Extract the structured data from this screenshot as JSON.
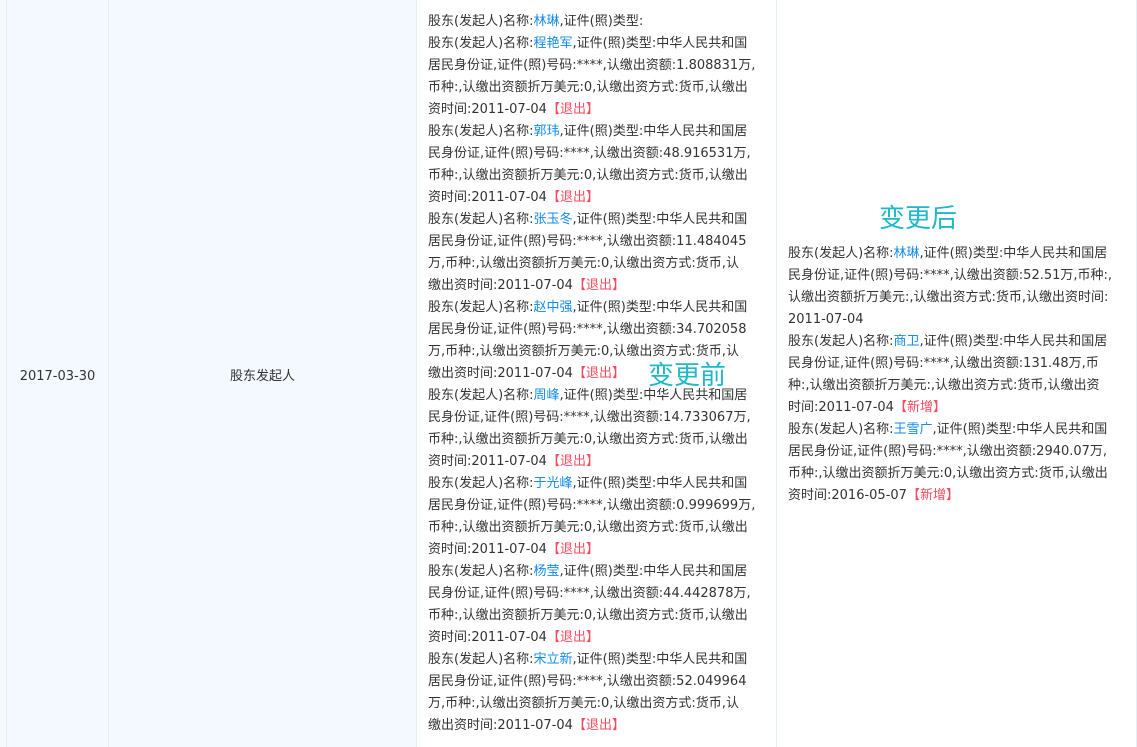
{
  "row": {
    "date": "2017-03-30",
    "item": "股东发起人"
  },
  "before": {
    "label": "变更前",
    "lines": [
      [
        [
          "t",
          "股东(发起人)名称:"
        ],
        [
          "l",
          "林琳"
        ],
        [
          "t",
          ",证件(照)类型:"
        ]
      ],
      [
        [
          "t",
          "股东(发起人)名称:"
        ],
        [
          "l",
          "程艳军"
        ],
        [
          "t",
          ",证件(照)类型:中华人民共和国"
        ]
      ],
      [
        [
          "t",
          "居民身份证,证件(照)号码:****,认缴出资额:1.808831万,"
        ]
      ],
      [
        [
          "t",
          "币种:,认缴出资额折万美元:0,认缴出资方式:货币,认缴出"
        ]
      ],
      [
        [
          "t",
          "资时间:2011-07-04"
        ],
        [
          "x",
          "【退出】"
        ]
      ],
      [
        [
          "t",
          "股东(发起人)名称:"
        ],
        [
          "l",
          "郭玮"
        ],
        [
          "t",
          ",证件(照)类型:中华人民共和国居"
        ]
      ],
      [
        [
          "t",
          "民身份证,证件(照)号码:****,认缴出资额:48.916531万,"
        ]
      ],
      [
        [
          "t",
          "币种:,认缴出资额折万美元:0,认缴出资方式:货币,认缴出"
        ]
      ],
      [
        [
          "t",
          "资时间:2011-07-04"
        ],
        [
          "x",
          "【退出】"
        ]
      ],
      [
        [
          "t",
          "股东(发起人)名称:"
        ],
        [
          "l",
          "张玉冬"
        ],
        [
          "t",
          ",证件(照)类型:中华人民共和国"
        ]
      ],
      [
        [
          "t",
          "居民身份证,证件(照)号码:****,认缴出资额:11.484045"
        ]
      ],
      [
        [
          "t",
          "万,币种:,认缴出资额折万美元:0,认缴出资方式:货币,认"
        ]
      ],
      [
        [
          "t",
          "缴出资时间:2011-07-04"
        ],
        [
          "x",
          "【退出】"
        ]
      ],
      [
        [
          "t",
          "股东(发起人)名称:"
        ],
        [
          "l",
          "赵中强"
        ],
        [
          "t",
          ",证件(照)类型:中华人民共和国"
        ]
      ],
      [
        [
          "t",
          "居民身份证,证件(照)号码:****,认缴出资额:34.702058"
        ]
      ],
      [
        [
          "t",
          "万,币种:,认缴出资额折万美元:0,认缴出资方式:货币,认"
        ]
      ],
      [
        [
          "t",
          "缴出资时间:2011-07-04"
        ],
        [
          "x",
          "【退出】"
        ]
      ],
      [
        [
          "t",
          "股东(发起人)名称:"
        ],
        [
          "l",
          "周峰"
        ],
        [
          "t",
          ",证件(照)类型:中华人民共和国居"
        ]
      ],
      [
        [
          "t",
          "民身份证,证件(照)号码:****,认缴出资额:14.733067万,"
        ]
      ],
      [
        [
          "t",
          "币种:,认缴出资额折万美元:0,认缴出资方式:货币,认缴出"
        ]
      ],
      [
        [
          "t",
          "资时间:2011-07-04"
        ],
        [
          "x",
          "【退出】"
        ]
      ],
      [
        [
          "t",
          "股东(发起人)名称:"
        ],
        [
          "l",
          "于光峰"
        ],
        [
          "t",
          ",证件(照)类型:中华人民共和国"
        ]
      ],
      [
        [
          "t",
          "居民身份证,证件(照)号码:****,认缴出资额:0.999699万,"
        ]
      ],
      [
        [
          "t",
          "币种:,认缴出资额折万美元:0,认缴出资方式:货币,认缴出"
        ]
      ],
      [
        [
          "t",
          "资时间:2011-07-04"
        ],
        [
          "x",
          "【退出】"
        ]
      ],
      [
        [
          "t",
          "股东(发起人)名称:"
        ],
        [
          "l",
          "杨莹"
        ],
        [
          "t",
          ",证件(照)类型:中华人民共和国居"
        ]
      ],
      [
        [
          "t",
          "民身份证,证件(照)号码:****,认缴出资额:44.442878万,"
        ]
      ],
      [
        [
          "t",
          "币种:,认缴出资额折万美元:0,认缴出资方式:货币,认缴出"
        ]
      ],
      [
        [
          "t",
          "资时间:2011-07-04"
        ],
        [
          "x",
          "【退出】"
        ]
      ],
      [
        [
          "t",
          "股东(发起人)名称:"
        ],
        [
          "l",
          "宋立新"
        ],
        [
          "t",
          ",证件(照)类型:中华人民共和国"
        ]
      ],
      [
        [
          "t",
          "居民身份证,证件(照)号码:****,认缴出资额:52.049964"
        ]
      ],
      [
        [
          "t",
          "万,币种:,认缴出资额折万美元:0,认缴出资方式:货币,认"
        ]
      ],
      [
        [
          "t",
          "缴出资时间:2011-07-04"
        ],
        [
          "x",
          "【退出】"
        ]
      ]
    ]
  },
  "after": {
    "label": "变更后",
    "lines": [
      [
        [
          "t",
          "股东(发起人)名称:"
        ],
        [
          "l",
          "林琳"
        ],
        [
          "t",
          ",证件(照)类型:中华人民共和国居"
        ]
      ],
      [
        [
          "t",
          "民身份证,证件(照)号码:****,认缴出资额:52.51万,币种:,"
        ]
      ],
      [
        [
          "t",
          "认缴出资额折万美元:,认缴出资方式:货币,认缴出资时间:"
        ]
      ],
      [
        [
          "t",
          "2011-07-04"
        ]
      ],
      [
        [
          "t",
          "股东(发起人)名称:"
        ],
        [
          "l",
          "商卫"
        ],
        [
          "t",
          ",证件(照)类型:中华人民共和国居"
        ]
      ],
      [
        [
          "t",
          "民身份证,证件(照)号码:****,认缴出资额:131.48万,币"
        ]
      ],
      [
        [
          "t",
          "种:,认缴出资额折万美元:,认缴出资方式:货币,认缴出资"
        ]
      ],
      [
        [
          "t",
          "时间:2011-07-04"
        ],
        [
          "n",
          "【新增】"
        ]
      ],
      [
        [
          "t",
          "股东(发起人)名称:"
        ],
        [
          "l",
          "王雪广"
        ],
        [
          "t",
          ",证件(照)类型:中华人民共和国"
        ]
      ],
      [
        [
          "t",
          "居民身份证,证件(照)号码:****,认缴出资额:2940.07万,"
        ]
      ],
      [
        [
          "t",
          "币种:,认缴出资额折万美元:0,认缴出资方式:货币,认缴出"
        ]
      ],
      [
        [
          "t",
          "资时间:2016-05-07"
        ],
        [
          "n",
          "【新增】"
        ]
      ]
    ]
  },
  "colors": {
    "link": "#128bed",
    "tag": "#fd485e",
    "overlay": "#1fb8c8",
    "row_bg": "#f3f9fe"
  }
}
